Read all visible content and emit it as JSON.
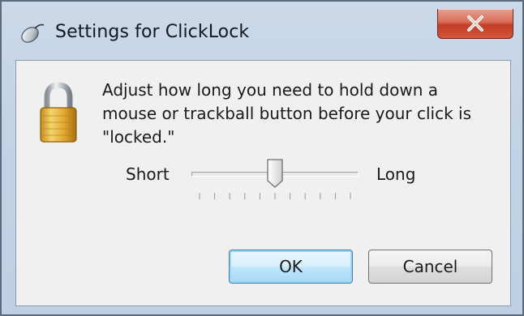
{
  "window": {
    "title": "Settings for ClickLock",
    "title_icon": "mouse-icon",
    "close_icon": "close-icon",
    "close_color": "#c9452d"
  },
  "content": {
    "icon": "padlock-icon",
    "instruction": "Adjust how long you need to hold down a mouse or trackball button before your click is \"locked.\""
  },
  "slider": {
    "min_label": "Short",
    "max_label": "Long",
    "tick_count": 11,
    "value_fraction": 0.5
  },
  "buttons": {
    "ok_label": "OK",
    "cancel_label": "Cancel"
  },
  "colors": {
    "frame": "#c3d3e6",
    "client": "#f0f0f0",
    "default_button_border": "#3c7fb1"
  }
}
